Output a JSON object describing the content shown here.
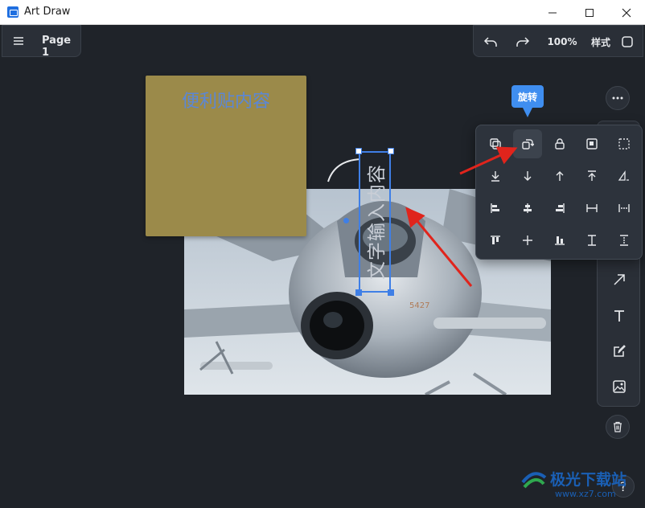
{
  "window": {
    "title": "Art Draw"
  },
  "header": {
    "page_label": "Page 1",
    "zoom": "100%",
    "style_label": "样式"
  },
  "sticky_note": {
    "text": "便利贴内容",
    "color": "#9b8a4a"
  },
  "text_element": {
    "text": "文字输入内容"
  },
  "tooltip": {
    "text": "旋转"
  },
  "watermark": {
    "text": "极光下载站",
    "url": "www.xz7.com"
  },
  "help": {
    "label": "?"
  },
  "popover": {
    "rows": [
      [
        "duplicate-icon",
        "rotate-icon",
        "lock-icon",
        "group-icon",
        "select-dashed-icon"
      ],
      [
        "move-to-bottom-icon",
        "move-down-icon",
        "move-up-icon",
        "move-to-top-icon",
        "flip-icon"
      ],
      [
        "align-left-icon",
        "align-center-horizontal-icon",
        "align-right-icon",
        "distribute-horizontal-icon",
        "space-horizontal-icon"
      ],
      [
        "align-top-icon",
        "align-middle-icon",
        "align-bottom-icon",
        "distribute-vertical-icon",
        "space-vertical-icon"
      ]
    ],
    "active": "rotate-icon"
  },
  "tools": [
    "arrow-tool-icon",
    "text-tool-icon",
    "pen-tool-icon",
    "image-tool-icon"
  ],
  "colors": {
    "accent": "#3f8ef0",
    "selection": "#3f7fe6",
    "annotation": "#e0241c"
  }
}
